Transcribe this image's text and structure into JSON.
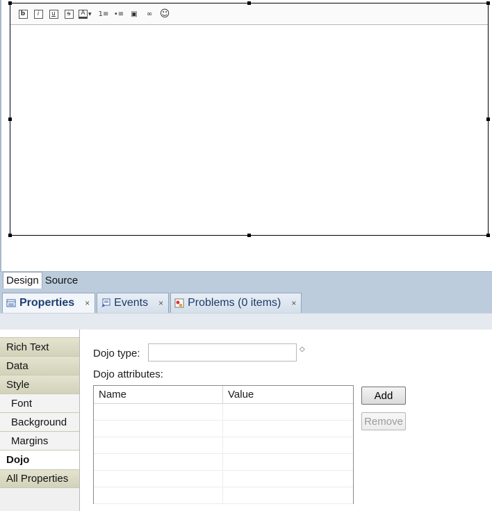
{
  "editor": {
    "toolbar": [
      {
        "icon": "bold-icon",
        "glyph": "b"
      },
      {
        "icon": "italic-icon",
        "glyph": "i"
      },
      {
        "icon": "underline-icon",
        "glyph": "u"
      },
      {
        "icon": "strikethrough-icon",
        "glyph": "s"
      },
      {
        "icon": "font-color-icon",
        "glyph": "A"
      },
      {
        "icon": "numbered-list-icon",
        "glyph": "1≡"
      },
      {
        "icon": "bulleted-list-icon",
        "glyph": "•≡"
      },
      {
        "icon": "image-icon",
        "glyph": "▣"
      },
      {
        "icon": "link-icon",
        "glyph": "∞"
      },
      {
        "icon": "emoticon-icon",
        "glyph": "☺"
      }
    ]
  },
  "editor_tabs": [
    "Design",
    "Source"
  ],
  "view_tabs": [
    {
      "label": "Properties",
      "icon": "properties-icon",
      "active": true
    },
    {
      "label": "Events",
      "icon": "events-icon",
      "active": false
    },
    {
      "label": "Problems (0 items)",
      "icon": "problems-icon",
      "active": false
    }
  ],
  "close_glyph": "×",
  "sidebar": {
    "items": [
      {
        "label": "Rich Text",
        "type": "group"
      },
      {
        "label": "Data",
        "type": "group"
      },
      {
        "label": "Style",
        "type": "group"
      },
      {
        "label": "Font",
        "type": "sub"
      },
      {
        "label": "Background",
        "type": "sub"
      },
      {
        "label": "Margins",
        "type": "sub"
      },
      {
        "label": "Dojo",
        "type": "selected"
      },
      {
        "label": "All Properties",
        "type": "group"
      }
    ]
  },
  "dojo": {
    "type_label": "Dojo type:",
    "type_value": "",
    "attributes_label": "Dojo attributes:",
    "columns": [
      "Name",
      "Value"
    ],
    "row_count": 6,
    "add_label": "Add",
    "remove_label": "Remove"
  },
  "colors": {
    "tab_strip": "#bcccdc",
    "tab_text": "#1c3f72",
    "group_bg": "#d9d9c3"
  }
}
